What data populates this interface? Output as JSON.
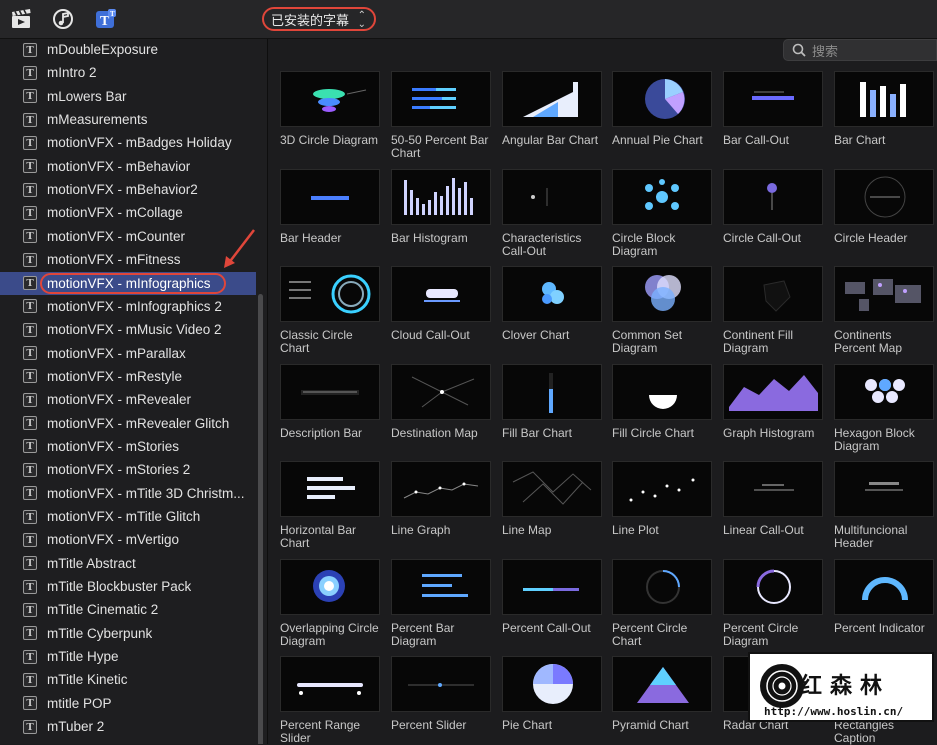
{
  "toolbar": {
    "icons": [
      "clapper-icon",
      "music-icon",
      "titles-icon"
    ],
    "popup_label": "已安装的字幕",
    "popup_chevron": "⌃⌄"
  },
  "search": {
    "placeholder": "搜索"
  },
  "sidebar": {
    "items": [
      {
        "label": "mDoubleExposure"
      },
      {
        "label": "mIntro 2"
      },
      {
        "label": "mLowers Bar"
      },
      {
        "label": "mMeasurements"
      },
      {
        "label": "motionVFX - mBadges Holiday"
      },
      {
        "label": "motionVFX - mBehavior"
      },
      {
        "label": "motionVFX - mBehavior2"
      },
      {
        "label": "motionVFX - mCollage"
      },
      {
        "label": "motionVFX - mCounter"
      },
      {
        "label": "motionVFX - mFitness"
      },
      {
        "label": "motionVFX - mInfographics",
        "selected": true
      },
      {
        "label": "motionVFX - mInfographics 2"
      },
      {
        "label": "motionVFX - mMusic Video 2"
      },
      {
        "label": "motionVFX - mParallax"
      },
      {
        "label": "motionVFX - mRestyle"
      },
      {
        "label": "motionVFX - mRevealer"
      },
      {
        "label": "motionVFX - mRevealer Glitch"
      },
      {
        "label": "motionVFX - mStories"
      },
      {
        "label": "motionVFX - mStories 2"
      },
      {
        "label": "motionVFX - mTitle 3D Christm..."
      },
      {
        "label": "motionVFX - mTitle Glitch"
      },
      {
        "label": "motionVFX - mVertigo"
      },
      {
        "label": "mTitle Abstract"
      },
      {
        "label": "mTitle Blockbuster Pack"
      },
      {
        "label": "mTitle Cinematic 2"
      },
      {
        "label": "mTitle Cyberpunk"
      },
      {
        "label": "mTitle Hype"
      },
      {
        "label": "mTitle Kinetic"
      },
      {
        "label": "mtitle POP"
      },
      {
        "label": "mTuber 2"
      }
    ]
  },
  "grid": {
    "tiles": [
      {
        "name": "3D Circle Diagram",
        "thumb": "circle3d"
      },
      {
        "name": "50-50 Percent Bar Chart",
        "thumb": "bars5050"
      },
      {
        "name": "Angular Bar Chart",
        "thumb": "angular"
      },
      {
        "name": "Annual Pie Chart",
        "thumb": "annualpie"
      },
      {
        "name": "Bar Call-Out",
        "thumb": "barcallout"
      },
      {
        "name": "Bar Chart",
        "thumb": "barchart"
      },
      {
        "name": "Bar Header",
        "thumb": "barheader"
      },
      {
        "name": "Bar Histogram",
        "thumb": "histogram"
      },
      {
        "name": "Characteristics Call-Out",
        "thumb": "dotcall"
      },
      {
        "name": "Circle Block Diagram",
        "thumb": "circleblock"
      },
      {
        "name": "Circle Call-Out",
        "thumb": "circlecall"
      },
      {
        "name": "Circle Header",
        "thumb": "circleheader"
      },
      {
        "name": "Classic Circle Chart",
        "thumb": "classiccircle"
      },
      {
        "name": "Cloud Call-Out",
        "thumb": "cloud"
      },
      {
        "name": "Clover Chart",
        "thumb": "clover"
      },
      {
        "name": "Common Set Diagram",
        "thumb": "venn"
      },
      {
        "name": "Continent Fill Diagram",
        "thumb": "continent"
      },
      {
        "name": "Continents Percent Map",
        "thumb": "worldmap"
      },
      {
        "name": "Description Bar",
        "thumb": "descbar"
      },
      {
        "name": "Destination Map",
        "thumb": "destmap"
      },
      {
        "name": "Fill Bar Chart",
        "thumb": "fillbar"
      },
      {
        "name": "Fill Circle Chart",
        "thumb": "fillcircle"
      },
      {
        "name": "Graph Histogram",
        "thumb": "graphhist"
      },
      {
        "name": "Hexagon Block Diagram",
        "thumb": "hexagon"
      },
      {
        "name": "Horizontal Bar Chart",
        "thumb": "hbar"
      },
      {
        "name": "Line Graph",
        "thumb": "linegraph"
      },
      {
        "name": "Line Map",
        "thumb": "linemap"
      },
      {
        "name": "Line Plot",
        "thumb": "lineplot"
      },
      {
        "name": "Linear Call-Out",
        "thumb": "linear"
      },
      {
        "name": "Multifuncional Header",
        "thumb": "multiheader"
      },
      {
        "name": "Overlapping Circle Diagram",
        "thumb": "overlap"
      },
      {
        "name": "Percent Bar Diagram",
        "thumb": "percentbar"
      },
      {
        "name": "Percent Call-Out",
        "thumb": "percentcall"
      },
      {
        "name": "Percent Circle Chart",
        "thumb": "percentcircle"
      },
      {
        "name": "Percent Circle Diagram",
        "thumb": "percentcircle2"
      },
      {
        "name": "Percent Indicator",
        "thumb": "indicator"
      },
      {
        "name": "Percent Range Slider",
        "thumb": "rangeslider"
      },
      {
        "name": "Percent Slider",
        "thumb": "slider"
      },
      {
        "name": "Pie Chart",
        "thumb": "pie"
      },
      {
        "name": "Pyramid Chart",
        "thumb": "pyramid"
      },
      {
        "name": "Radar Chart",
        "thumb": "radar"
      },
      {
        "name": "Rectangles Caption",
        "thumb": "rect"
      }
    ]
  },
  "watermark": {
    "brand": "红森林",
    "url": "http://www.hoslin.cn/"
  },
  "colors": {
    "accent": "#3b4b8a",
    "highlight": "#e0463a",
    "background": "#1c1c1e"
  }
}
